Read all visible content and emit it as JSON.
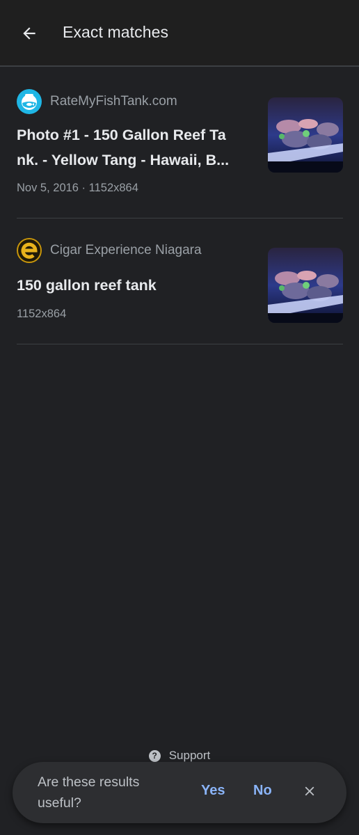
{
  "header": {
    "title": "Exact matches",
    "back_icon": "arrow-left-icon"
  },
  "results": [
    {
      "site": "RateMyFishTank.com",
      "favicon": "fishbowl-icon",
      "title_line1": "Photo #1 - 150 Gallon Reef Ta",
      "title_line2": "nk. - Yellow Tang - Hawaii, B...",
      "meta": "Nov 5, 2016 · 1152x864"
    },
    {
      "site": "Cigar Experience Niagara",
      "favicon": "e-logo-icon",
      "title_line1": "150 gallon reef tank",
      "meta": "1152x864"
    }
  ],
  "footer": {
    "support_label": "Support",
    "feedback_question": "Are these results useful?",
    "yes_label": "Yes",
    "no_label": "No",
    "close_icon": "close-icon"
  },
  "colors": {
    "background": "#202124",
    "appbar": "#1f1f1f",
    "accent": "#8ab4f8",
    "secondary_text": "#9aa0a6"
  }
}
